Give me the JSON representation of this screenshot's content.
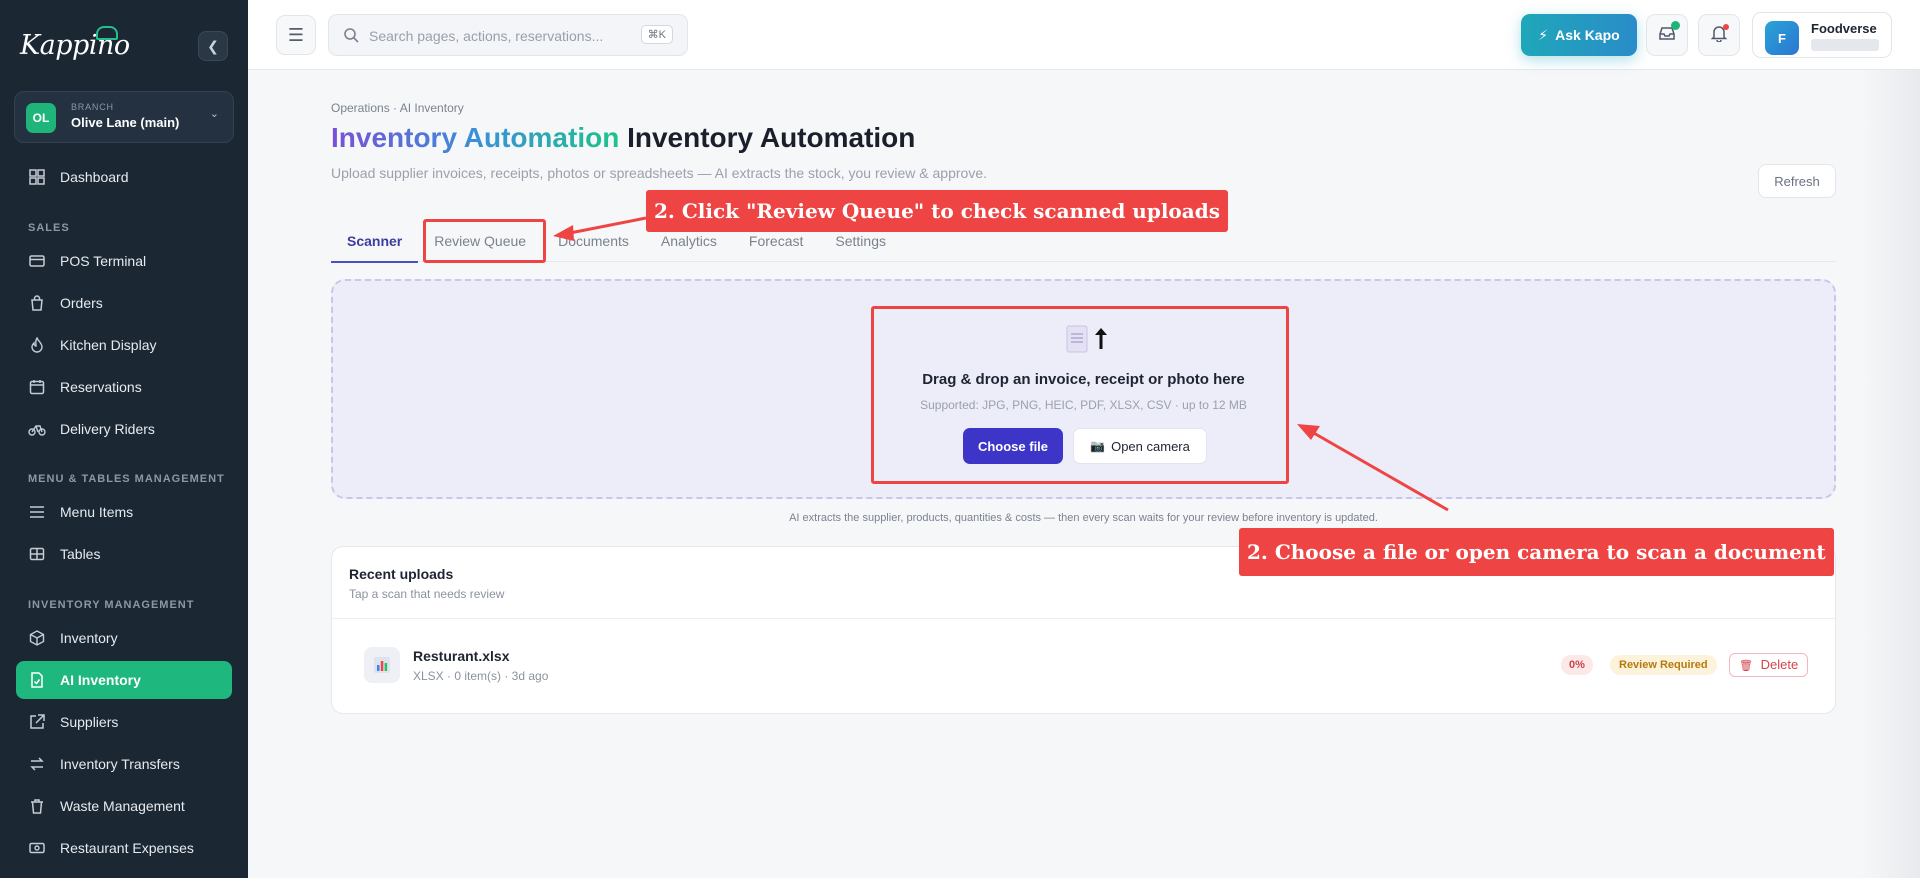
{
  "brand": {
    "name": "Kappino"
  },
  "branch": {
    "kicker": "BRANCH",
    "initials": "OL",
    "name": "Olive Lane (main)"
  },
  "sidebar": {
    "items": [
      {
        "label": "Dashboard",
        "icon": "dashboard-icon"
      },
      {
        "label": "POS Terminal",
        "icon": "pos-icon"
      },
      {
        "label": "Orders",
        "icon": "bag-icon"
      },
      {
        "label": "Kitchen Display",
        "icon": "flame-icon"
      },
      {
        "label": "Reservations",
        "icon": "calendar-icon"
      },
      {
        "label": "Delivery Riders",
        "icon": "bike-icon"
      },
      {
        "label": "Menu Items",
        "icon": "list-icon"
      },
      {
        "label": "Tables",
        "icon": "table-icon"
      },
      {
        "label": "Inventory",
        "icon": "box-icon"
      },
      {
        "label": "AI Inventory",
        "icon": "ai-doc-icon",
        "active": true
      },
      {
        "label": "Suppliers",
        "icon": "external-icon"
      },
      {
        "label": "Inventory Transfers",
        "icon": "transfer-icon"
      },
      {
        "label": "Waste Management",
        "icon": "trash-icon"
      },
      {
        "label": "Restaurant Expenses",
        "icon": "cash-icon"
      }
    ],
    "sections": [
      "SALES",
      "MENU & TABLES MANAGEMENT",
      "INVENTORY MANAGEMENT"
    ]
  },
  "topbar": {
    "search_placeholder": "Search pages, actions, reservations...",
    "shortcut": "⌘K",
    "ask_label": "Ask Kapo",
    "profile_name": "Foodverse",
    "profile_initial": "F"
  },
  "page": {
    "breadcrumb": "Operations · AI Inventory",
    "title_gradient": "Inventory Automation",
    "title_plain": "Inventory Automation",
    "subtitle": "Upload supplier invoices, receipts, photos or spreadsheets — AI extracts the stock, you review & approve.",
    "refresh_label": "Refresh",
    "tabs": [
      "Scanner",
      "Review Queue",
      "Documents",
      "Analytics",
      "Forecast",
      "Settings"
    ]
  },
  "dropzone": {
    "title": "Drag & drop an invoice, receipt or photo here",
    "supported": "Supported: JPG, PNG, HEIC, PDF, XLSX, CSV · up to 12 MB",
    "choose_label": "Choose file",
    "camera_label": "Open camera",
    "note": "AI extracts the supplier, products, quantities & costs — then every scan waits for your review before inventory is updated."
  },
  "recent": {
    "title": "Recent uploads",
    "subtitle": "Tap a scan that needs review",
    "files": [
      {
        "name": "Resturant.xlsx",
        "meta": "XLSX · 0 item(s) · 3d ago",
        "percent": "0%",
        "status": "Review Required",
        "delete_label": "Delete"
      }
    ]
  },
  "annotations": {
    "review_hint": "2. Click \"Review Queue\" to check scanned uploads",
    "upload_hint": "2. Choose a file or open camera to scan a document"
  },
  "colors": {
    "accent": "#1eb77d",
    "primary": "#3d35c8",
    "annotation": "#ef4444",
    "sidebar": "#1b2733"
  }
}
